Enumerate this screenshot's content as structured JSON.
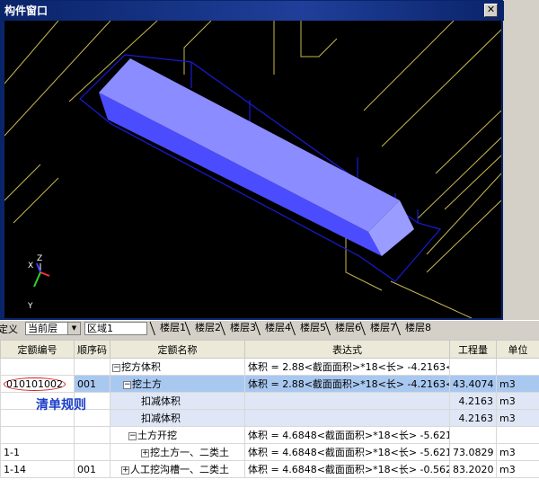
{
  "window": {
    "title": "构件窗口",
    "close_glyph": "✕",
    "axes": {
      "x": "X",
      "y": "Y",
      "z": "Z"
    },
    "colors": {
      "box_top": "#8a8cff",
      "box_side": "#4c4cff",
      "outline": "#1a1ad6",
      "grid_lines": "#c8b850"
    }
  },
  "tabstrip": {
    "def_label": "定义",
    "floor_combo": "当前层",
    "area_label": "区域1",
    "floors": [
      "楼层1",
      "楼层2",
      "楼层3",
      "楼层4",
      "楼层5",
      "楼层6",
      "楼层7",
      "楼层8"
    ]
  },
  "grid": {
    "headers": [
      "定额编号",
      "顺序码",
      "定额名称",
      "表达式",
      "工程量",
      "单位"
    ],
    "rows": [
      {
        "code": "",
        "seq": "",
        "tree": "⊟",
        "name": "挖方体积",
        "expr": "体积 = 2.88<截面面积>*18<长> -4.2163<",
        "qty": "",
        "unit": ""
      },
      {
        "code": "010101002",
        "seq": "001",
        "tree": "⊟",
        "name": "挖土方",
        "expr": "体积 = 2.88<截面面积>*18<长> -4.2163<",
        "qty": "43.4074",
        "unit": "m3"
      },
      {
        "code": "",
        "seq": "",
        "tree": "",
        "name": "扣减体积",
        "expr": "",
        "qty": "4.2163",
        "unit": "m3"
      },
      {
        "code": "",
        "seq": "",
        "tree": "",
        "name": "扣减体积",
        "expr": "",
        "qty": "4.2163",
        "unit": "m3"
      },
      {
        "code": "",
        "seq": "",
        "tree": "⊟",
        "name": "土方开挖",
        "expr": "体积 = 4.6848<截面面积>*18<长> -5.621",
        "qty": "",
        "unit": ""
      },
      {
        "code": "1-1",
        "seq": "",
        "tree": "⊞",
        "name": "挖土方一、二类土",
        "expr": "体积 = 4.6848<截面面积>*18<长> -5.621",
        "qty": "73.0829",
        "unit": "m3"
      },
      {
        "code": "1-14",
        "seq": "001",
        "tree": "⊞",
        "name": "人工挖沟槽一、二类土",
        "expr": "体积 = 4.6848<截面面积>*18<长> -0.562",
        "qty": "83.2020",
        "unit": "m3"
      }
    ],
    "annotation": "清单规则"
  }
}
